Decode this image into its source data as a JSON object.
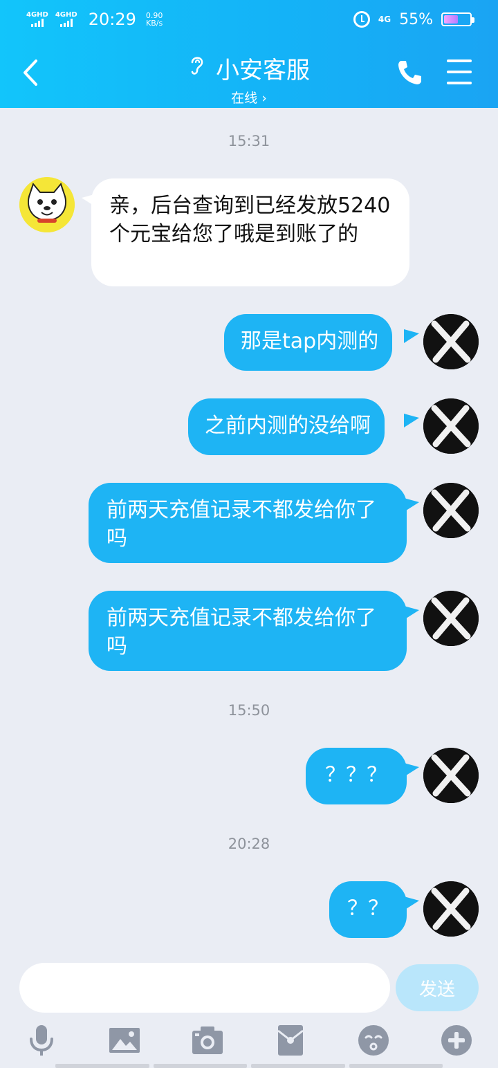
{
  "status_bar": {
    "sim1": "4GHD",
    "sim2": "4GHD",
    "time": "20:29",
    "net_speed": "0.90",
    "net_unit": "KB/s",
    "network": "4G",
    "battery_percent": "55%",
    "battery_level": 0.55
  },
  "header": {
    "title": "小安客服",
    "subtitle": "在线 ›",
    "icons": [
      "back-arrow-icon",
      "ear-icon",
      "phone-icon",
      "menu-icon"
    ]
  },
  "messages": {
    "ts1": "15:31",
    "m1": "亲，后台查询到已经发放5240个元宝给您了哦是到账了的",
    "m2": "那是tap内测的",
    "m3": "之前内测的没给啊",
    "m4": "前两天充值记录不都发给你了吗",
    "m5": "前两天充值记录不都发给你了吗",
    "ts2": "15:50",
    "m6": "？？？",
    "ts3": "20:28",
    "m7": "？？"
  },
  "input": {
    "placeholder": "",
    "send_label": "发送"
  },
  "toolbar_icons": [
    "microphone-icon",
    "image-icon",
    "camera-icon",
    "red-packet-icon",
    "emoji-icon",
    "plus-icon"
  ],
  "colors": {
    "header_start": "#12c5fb",
    "header_end": "#1aa4f3",
    "outgoing_bubble": "#1eb4f4",
    "incoming_bubble": "#ffffff",
    "background": "#eaedf4",
    "send_disabled": "#b9e6fb"
  }
}
